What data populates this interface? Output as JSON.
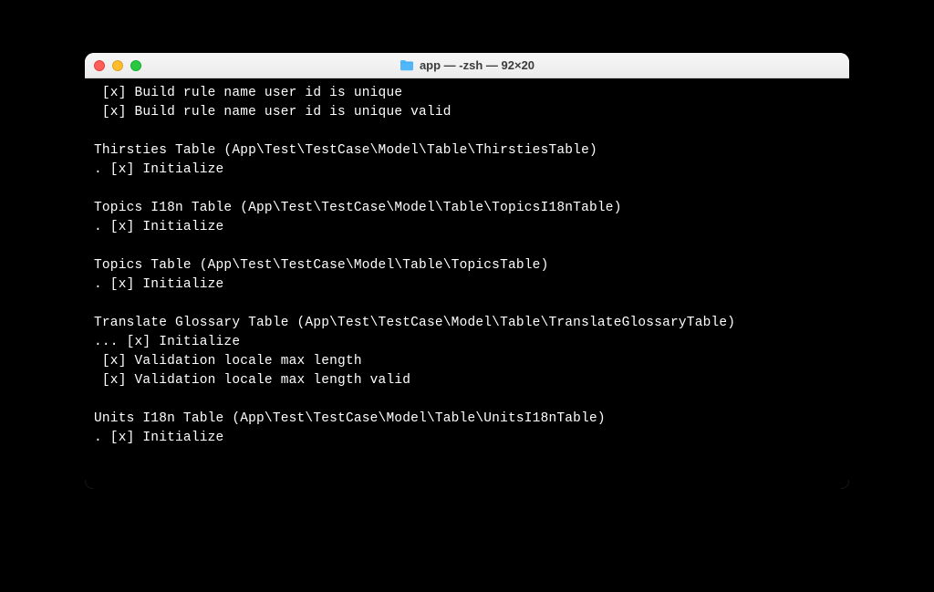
{
  "window": {
    "title": "app — -zsh — 92×20"
  },
  "terminal": {
    "lines": [
      " [x] Build rule name user id is unique",
      " [x] Build rule name user id is unique valid",
      "",
      "Thirsties Table (App\\Test\\TestCase\\Model\\Table\\ThirstiesTable)",
      ". [x] Initialize",
      "",
      "Topics I18n Table (App\\Test\\TestCase\\Model\\Table\\TopicsI18nTable)",
      ". [x] Initialize",
      "",
      "Topics Table (App\\Test\\TestCase\\Model\\Table\\TopicsTable)",
      ". [x] Initialize",
      "",
      "Translate Glossary Table (App\\Test\\TestCase\\Model\\Table\\TranslateGlossaryTable)",
      "... [x] Initialize",
      " [x] Validation locale max length",
      " [x] Validation locale max length valid",
      "",
      "Units I18n Table (App\\Test\\TestCase\\Model\\Table\\UnitsI18nTable)",
      ". [x] Initialize"
    ]
  }
}
